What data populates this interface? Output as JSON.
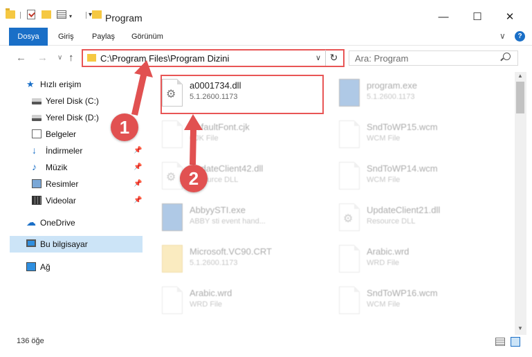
{
  "window": {
    "title": "Program",
    "minimize": "—",
    "maximize": "☐",
    "close": "✕"
  },
  "ribbon": {
    "tabs": [
      "Dosya",
      "Giriş",
      "Paylaş",
      "Görünüm"
    ],
    "expand": "∨"
  },
  "help_label": "?",
  "nav": {
    "back": "←",
    "forward": "→",
    "recent": "∨",
    "up": "↑"
  },
  "address": {
    "path": "C:\\Program Files\\Program Dizini",
    "chevron": "∨",
    "refresh": "↻"
  },
  "search": {
    "placeholder": "Ara: Program"
  },
  "sidebar": {
    "items": [
      {
        "label": "Hızlı erişim",
        "icon": "star-icon"
      },
      {
        "label": "Yerel Disk (C:)",
        "icon": "drive-icon"
      },
      {
        "label": "Yerel Disk (D:)",
        "icon": "drive-icon"
      },
      {
        "label": "Belgeler",
        "icon": "documents-icon"
      },
      {
        "label": "İndirmeler",
        "icon": "downloads-icon"
      },
      {
        "label": "Müzik",
        "icon": "music-icon"
      },
      {
        "label": "Resimler",
        "icon": "pictures-icon"
      },
      {
        "label": "Videolar",
        "icon": "videos-icon"
      },
      {
        "label": "OneDrive",
        "icon": "cloud-icon"
      },
      {
        "label": "Bu bilgisayar",
        "icon": "computer-icon"
      },
      {
        "label": "Ağ",
        "icon": "network-icon"
      }
    ]
  },
  "files": [
    {
      "name": "a0001734.dll",
      "sub": "5.1.2600.1173"
    },
    {
      "name": "program.exe",
      "sub": "5.1.2600.1173"
    },
    {
      "name": "DefaultFont.cjk",
      "sub": "CJK File"
    },
    {
      "name": "SndToWP15.wcm",
      "sub": "WCM File"
    },
    {
      "name": "UpdateClient42.dll",
      "sub": "Resource DLL"
    },
    {
      "name": "SndToWP14.wcm",
      "sub": "WCM File"
    },
    {
      "name": "AbbyySTI.exe",
      "sub": "ABBY sti event hand..."
    },
    {
      "name": "UpdateClient21.dll",
      "sub": "Resource DLL"
    },
    {
      "name": "Microsoft.VC90.CRT",
      "sub": "5.1.2600.1173"
    },
    {
      "name": "Arabic.wrd",
      "sub": "WRD File"
    },
    {
      "name": "Arabic.wrd",
      "sub": "WRD File"
    },
    {
      "name": "SndToWP16.wcm",
      "sub": "WCM File"
    }
  ],
  "status": {
    "count": "136 öğe"
  },
  "annotations": {
    "badge1": "1",
    "badge2": "2"
  },
  "colors": {
    "accent": "#1a6fc7",
    "annotation": "#e15151",
    "selected": "#cce4f7"
  }
}
